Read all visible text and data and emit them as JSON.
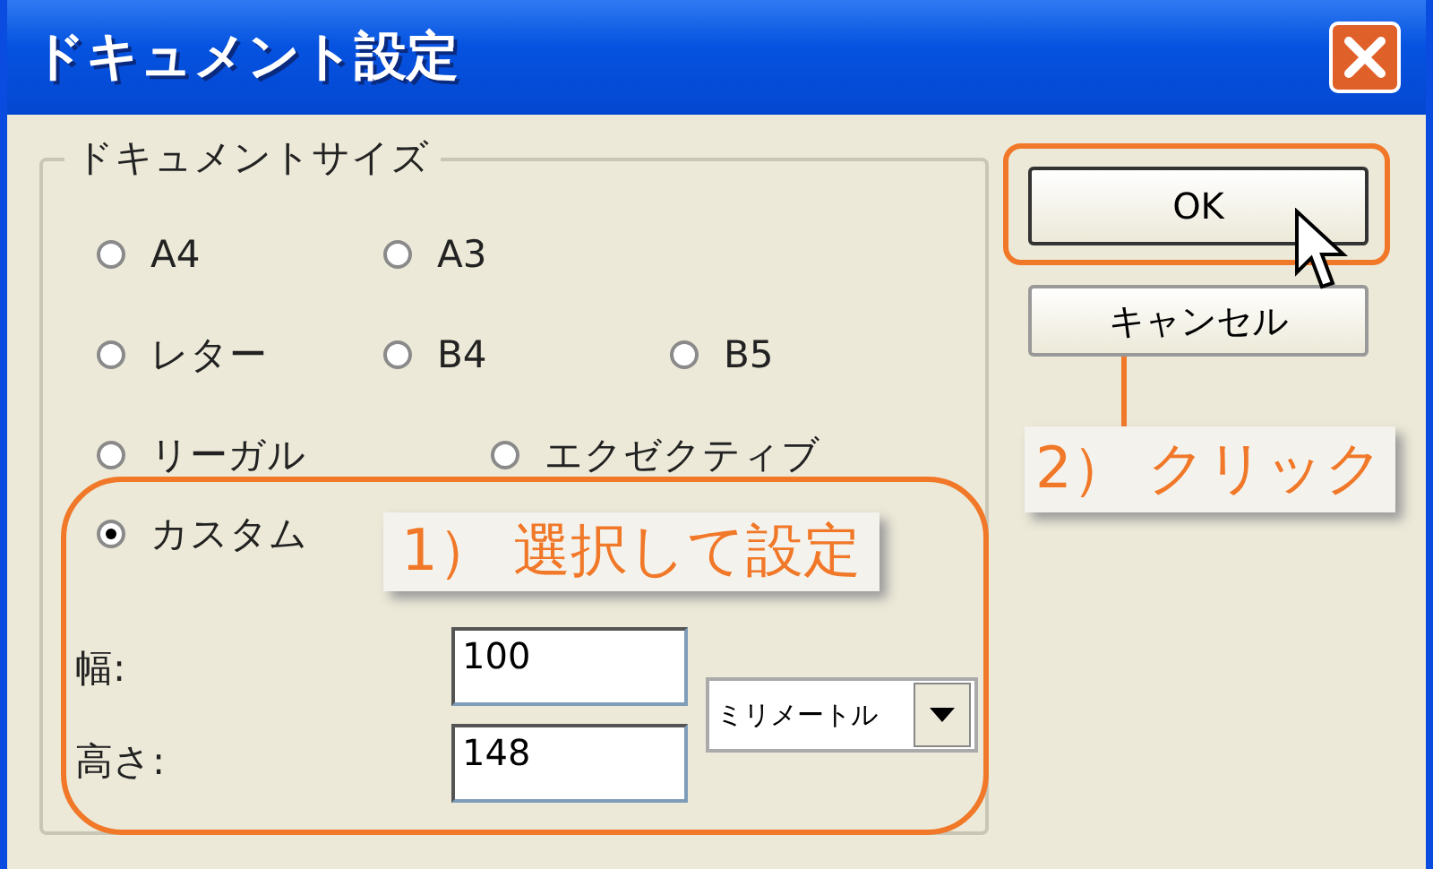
{
  "window": {
    "title": "ドキュメント設定"
  },
  "size_group": {
    "title": "ドキュメントサイズ",
    "options": [
      {
        "label": "A4",
        "selected": false
      },
      {
        "label": "A3",
        "selected": false
      },
      {
        "label": "レター",
        "selected": false
      },
      {
        "label": "B4",
        "selected": false
      },
      {
        "label": "B5",
        "selected": false
      },
      {
        "label": "リーガル",
        "selected": false
      },
      {
        "label": "エクゼクティブ",
        "selected": false
      }
    ],
    "custom": {
      "label": "カスタム",
      "selected": true
    },
    "width": {
      "label": "幅:",
      "value": "100"
    },
    "height": {
      "label": "高さ:",
      "value": "148"
    },
    "unit": {
      "value": "ミリメートル"
    }
  },
  "buttons": [
    {
      "label": "OK"
    },
    {
      "label": "キャンセル"
    }
  ],
  "annotations": [
    {
      "text": "1） 選択して設定"
    },
    {
      "text": "2） クリック"
    }
  ]
}
